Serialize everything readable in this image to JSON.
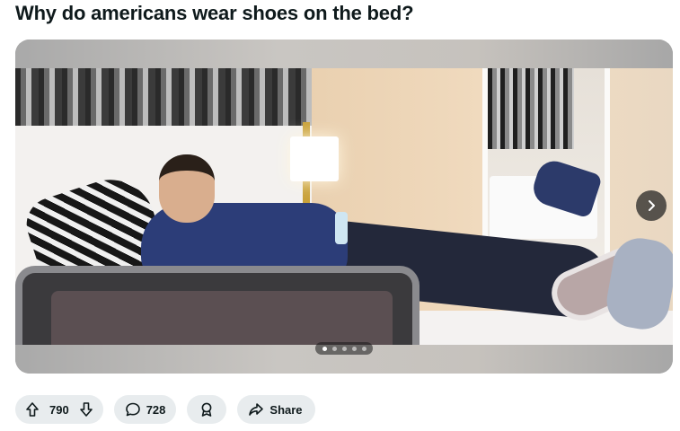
{
  "post": {
    "title": "Why do americans wear shoes on the bed?"
  },
  "gallery": {
    "image_alt": "Man lying on a hotel bed wearing shoes",
    "total_images": 5,
    "active_index": 1,
    "next_icon": "chevron-right-icon"
  },
  "actions": {
    "upvote_icon": "arrow-up-icon",
    "vote_count": "790",
    "downvote_icon": "arrow-down-icon",
    "comment_icon": "comment-icon",
    "comment_count": "728",
    "award_icon": "award-icon",
    "share_icon": "share-icon",
    "share_label": "Share"
  },
  "colors": {
    "pill_bg": "#e8ecee",
    "text": "#0f1a1c"
  }
}
